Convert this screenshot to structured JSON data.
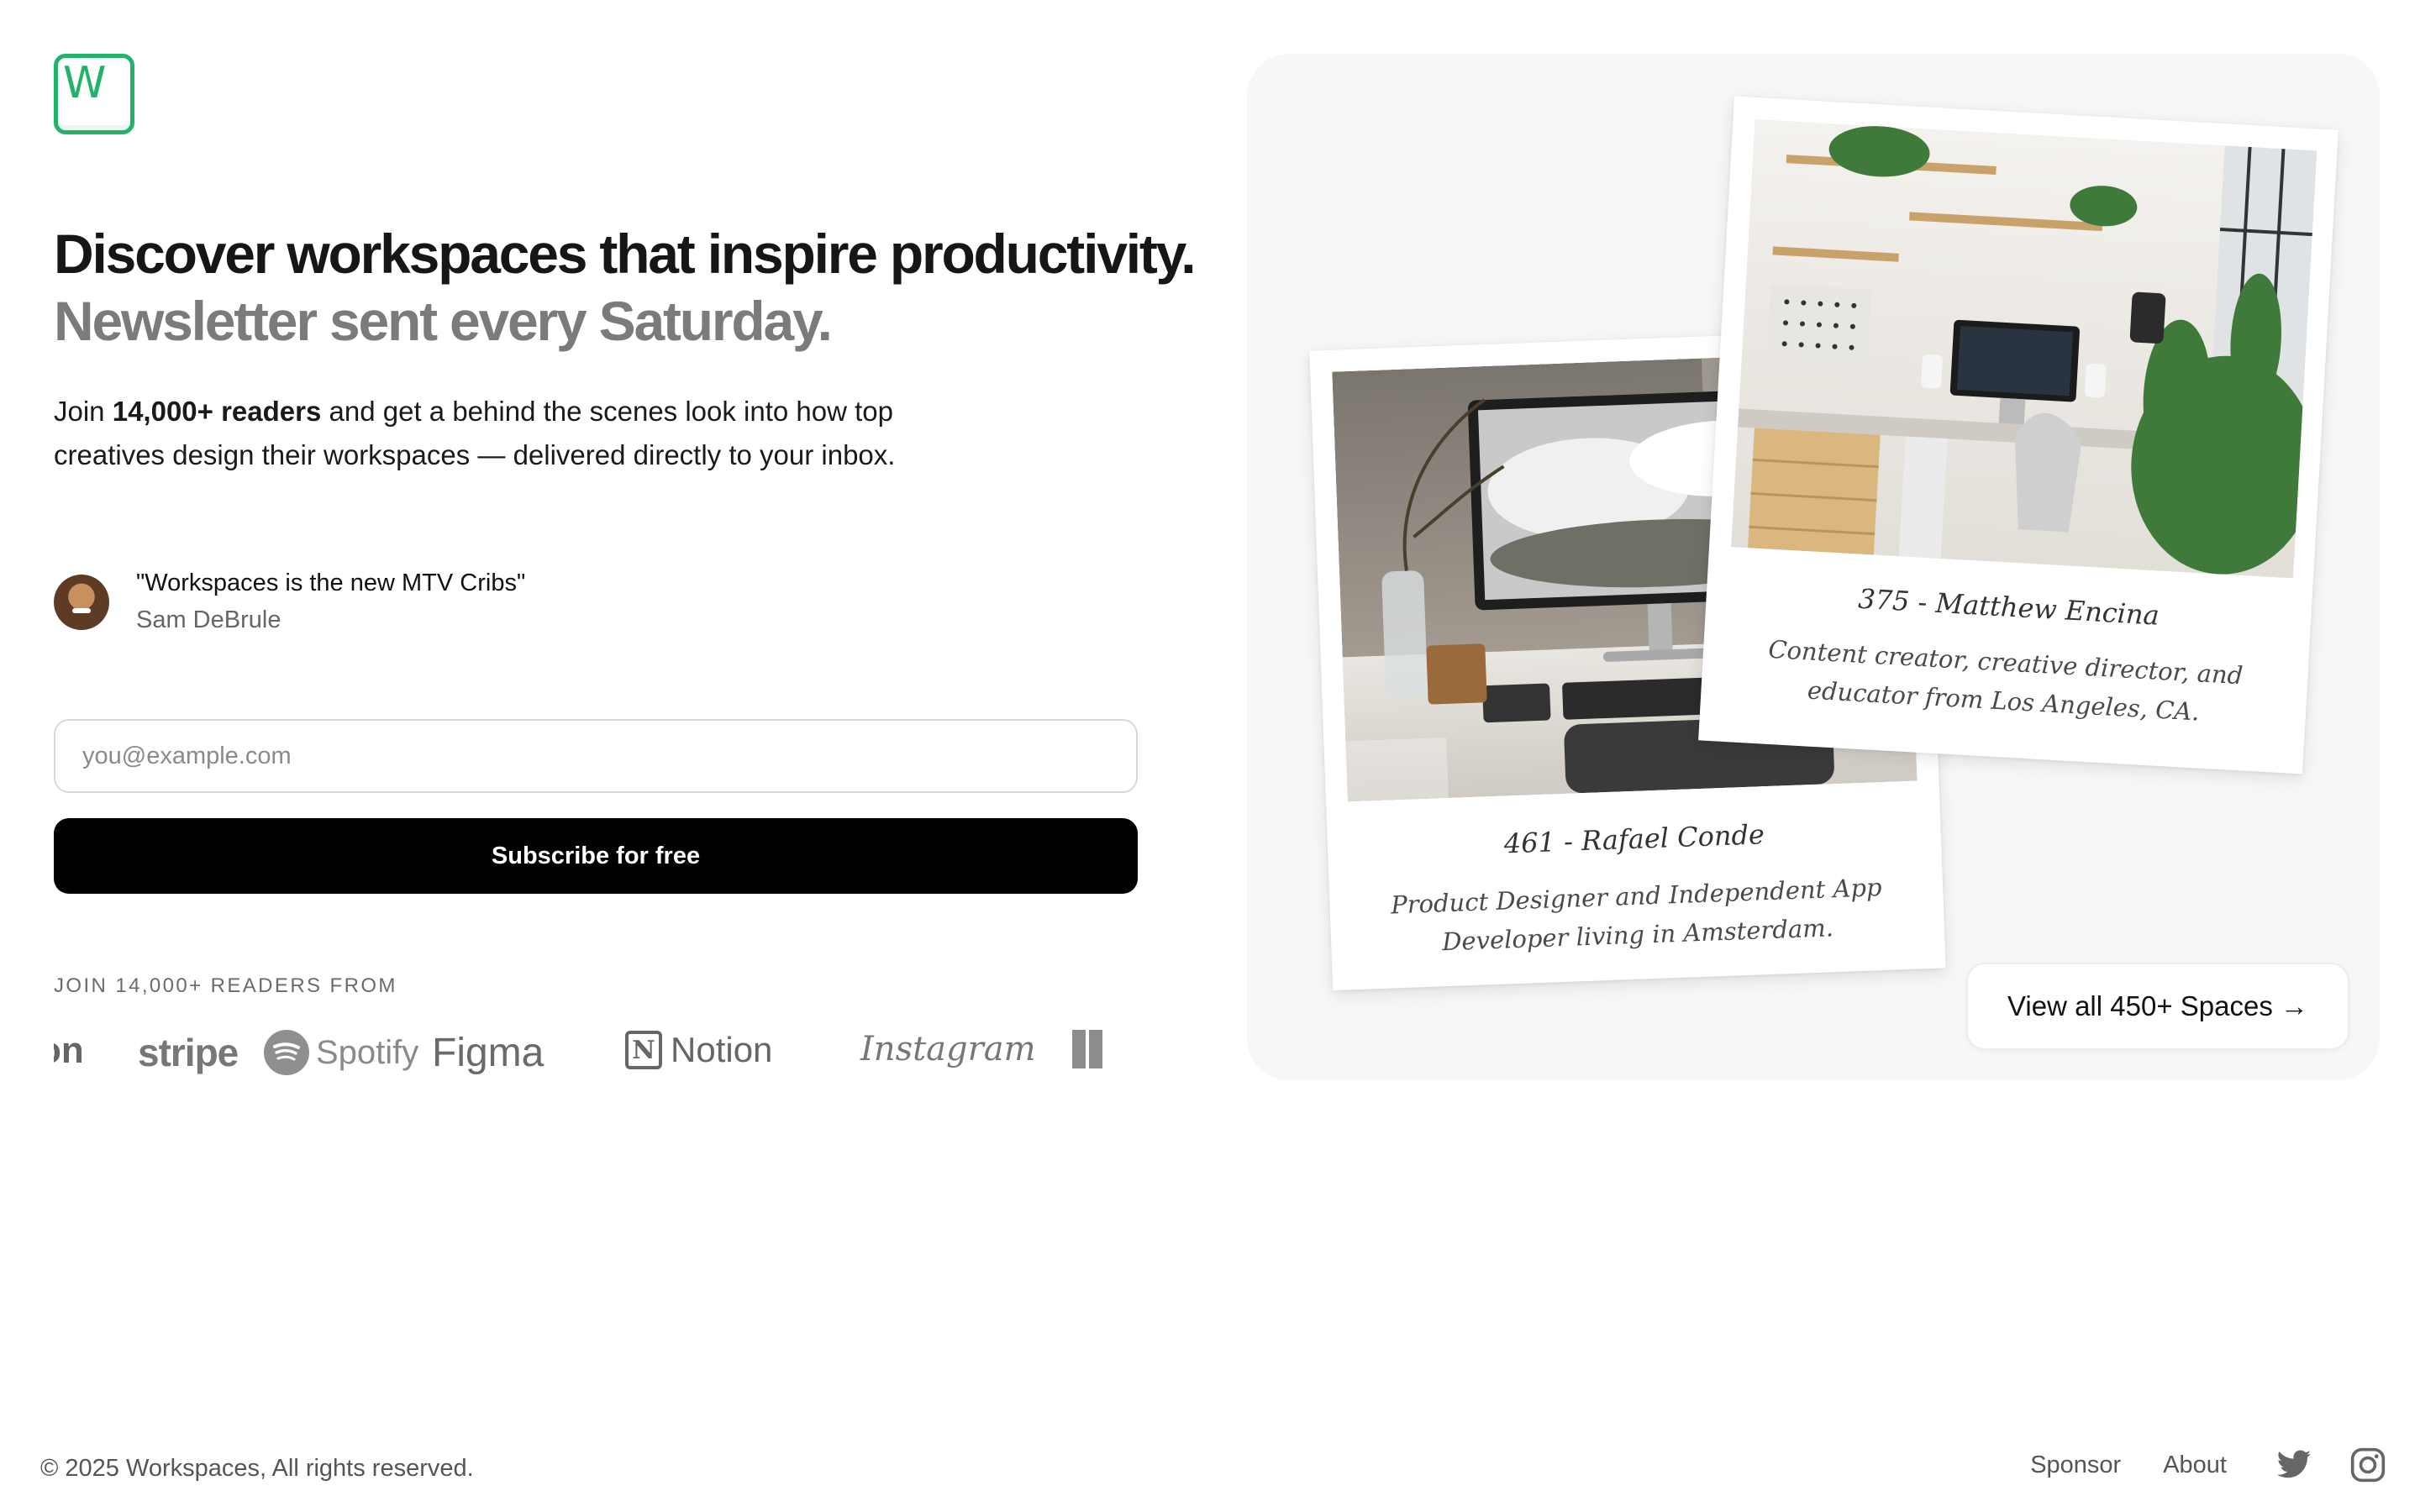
{
  "brand": {
    "logo_letter": "W",
    "accent_color": "#22b36a"
  },
  "hero": {
    "headline": "Discover workspaces that inspire productivity.",
    "subheadline": "Newsletter sent every Saturday.",
    "intro_before": "Join ",
    "intro_bold": "14,000+ readers",
    "intro_after": " and get a behind the scenes look into how top creatives design their workspaces — delivered directly to your inbox."
  },
  "testimonial": {
    "quote": "\"Workspaces is the new MTV Cribs\"",
    "author": "Sam DeBrule"
  },
  "form": {
    "email_placeholder": "you@example.com",
    "email_value": "",
    "subscribe_label": "Subscribe for free"
  },
  "readers": {
    "caption": "JOIN 14,000+ READERS FROM",
    "logos": [
      "zon",
      "stripe",
      "Spotify",
      "Figma",
      "Notion",
      "Instagram"
    ]
  },
  "showcase": {
    "cards": [
      {
        "name": "461 - Rafael Conde",
        "description": "Product Designer and Independent App Developer living in Amsterdam."
      },
      {
        "name": "375 - Matthew Encina",
        "description": "Content creator, creative director, and educator from Los Angeles, CA."
      }
    ],
    "view_all_label": "View all 450+ Spaces →"
  },
  "footer": {
    "copyright": "© 2025 Workspaces, All rights reserved.",
    "links": [
      "Sponsor",
      "About"
    ],
    "social": [
      "twitter-icon",
      "instagram-icon"
    ]
  }
}
